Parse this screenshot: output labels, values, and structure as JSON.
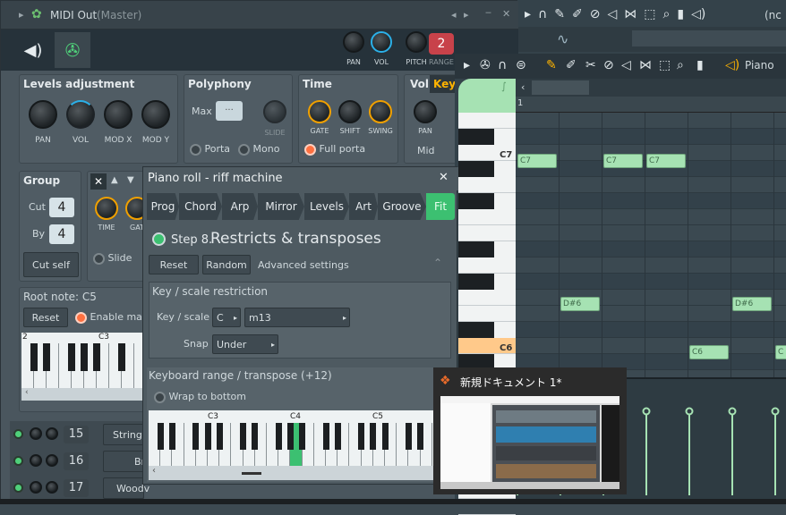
{
  "channel": {
    "title": "MIDI Out",
    "title_suffix": "(Master)",
    "knobs_top": {
      "pan": "PAN",
      "vol": "VOL",
      "pitch": "PITCH",
      "range": "RANGE",
      "range_value": "2"
    },
    "levels": {
      "title": "Levels adjustment",
      "knobs": [
        "PAN",
        "VOL",
        "MOD X",
        "MOD Y"
      ]
    },
    "polyphony": {
      "title": "Polyphony",
      "max_label": "Max",
      "max_value": "···",
      "slide": "SLIDE",
      "porta": "Porta",
      "mono": "Mono"
    },
    "time": {
      "title": "Time",
      "knobs": [
        "GATE",
        "SHIFT",
        "SWING"
      ],
      "full_porta": "Full porta"
    },
    "vol_key": {
      "vol": "Vol",
      "key": "Key",
      "pan": "PAN",
      "mid": "Mid"
    },
    "group": {
      "title": "Group",
      "cut_label": "Cut",
      "cut_value": "4",
      "by_label": "By",
      "by_value": "4",
      "cut_self": "Cut self"
    },
    "mini_knobs": [
      "TIME",
      "GAT"
    ],
    "slide": "Slide",
    "root_note": "Root note: C5",
    "reset": "Reset",
    "enable_main": "Enable mair",
    "keyboard_labels": [
      "2",
      "C3"
    ]
  },
  "channels": [
    {
      "num": "15",
      "name": "String"
    },
    {
      "num": "16",
      "name": "Bras"
    },
    {
      "num": "17",
      "name": "Woodv"
    }
  ],
  "top_bar": {
    "right_text": "(nc"
  },
  "piano_roll": {
    "title": "Piano",
    "bar_number": "1",
    "key_labels": [
      "C7",
      "C6"
    ],
    "notes": [
      {
        "label": "C7",
        "pitch": "C7",
        "start": 0.0
      },
      {
        "label": "C7",
        "pitch": "C7",
        "start": 1.5
      },
      {
        "label": "C7",
        "pitch": "C7",
        "start": 2.25
      },
      {
        "label": "D#6",
        "pitch": "D#6",
        "start": 0.75
      },
      {
        "label": "D#6",
        "pitch": "D#6",
        "start": 3.75
      },
      {
        "label": "C6",
        "pitch": "C6",
        "start": 3.0
      },
      {
        "label": "C",
        "pitch": "C6",
        "start": 4.5
      }
    ]
  },
  "riff": {
    "title": "Piano roll - riff machine",
    "tabs": [
      "Prog",
      "Chord",
      "Arp",
      "Mirror",
      "Levels",
      "Art",
      "Groove",
      "Fit"
    ],
    "step_label": "Step 8.",
    "step_title": "Restricts & transposes",
    "reset": "Reset",
    "random": "Random",
    "advanced": "Advanced settings",
    "key_section": "Key / scale restriction",
    "key_scale_label": "Key / scale",
    "key_value": "C",
    "scale_value": "m13",
    "snap_label": "Snap",
    "snap_value": "Under",
    "range_section": "Keyboard range / transpose (+12)",
    "wrap": "Wrap to bottom",
    "kb_labels": [
      "C3",
      "C4",
      "C5"
    ]
  },
  "thumbnail": {
    "title": "新規ドキュメント 1*"
  },
  "colors": {
    "accent_orange": "#f0a000",
    "note_green": "#a6e2b3",
    "active_tab": "#3cc071",
    "key_highlight": "#ff9800"
  }
}
